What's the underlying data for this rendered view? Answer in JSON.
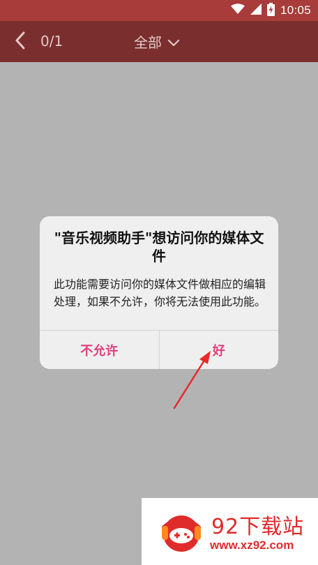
{
  "status_bar": {
    "time": "10:05",
    "icons": [
      "wifi-icon",
      "signal-icon",
      "battery-charging-icon"
    ],
    "background": "#a83c3a"
  },
  "header": {
    "page_count": "0/1",
    "filter_label": "全部",
    "background": "#7a2f2e"
  },
  "dialog": {
    "title": "\"音乐视频助手\"想访问你的媒体文件",
    "message": "此功能需要访问你的媒体文件做相应的编辑处理，如果不允许，你将无法使用此功能。",
    "deny_label": "不允许",
    "allow_label": "好",
    "button_color": "#e0407a"
  },
  "watermark": {
    "name": "92下载站",
    "url": "www.xz92.com",
    "color": "#e02b2b"
  }
}
